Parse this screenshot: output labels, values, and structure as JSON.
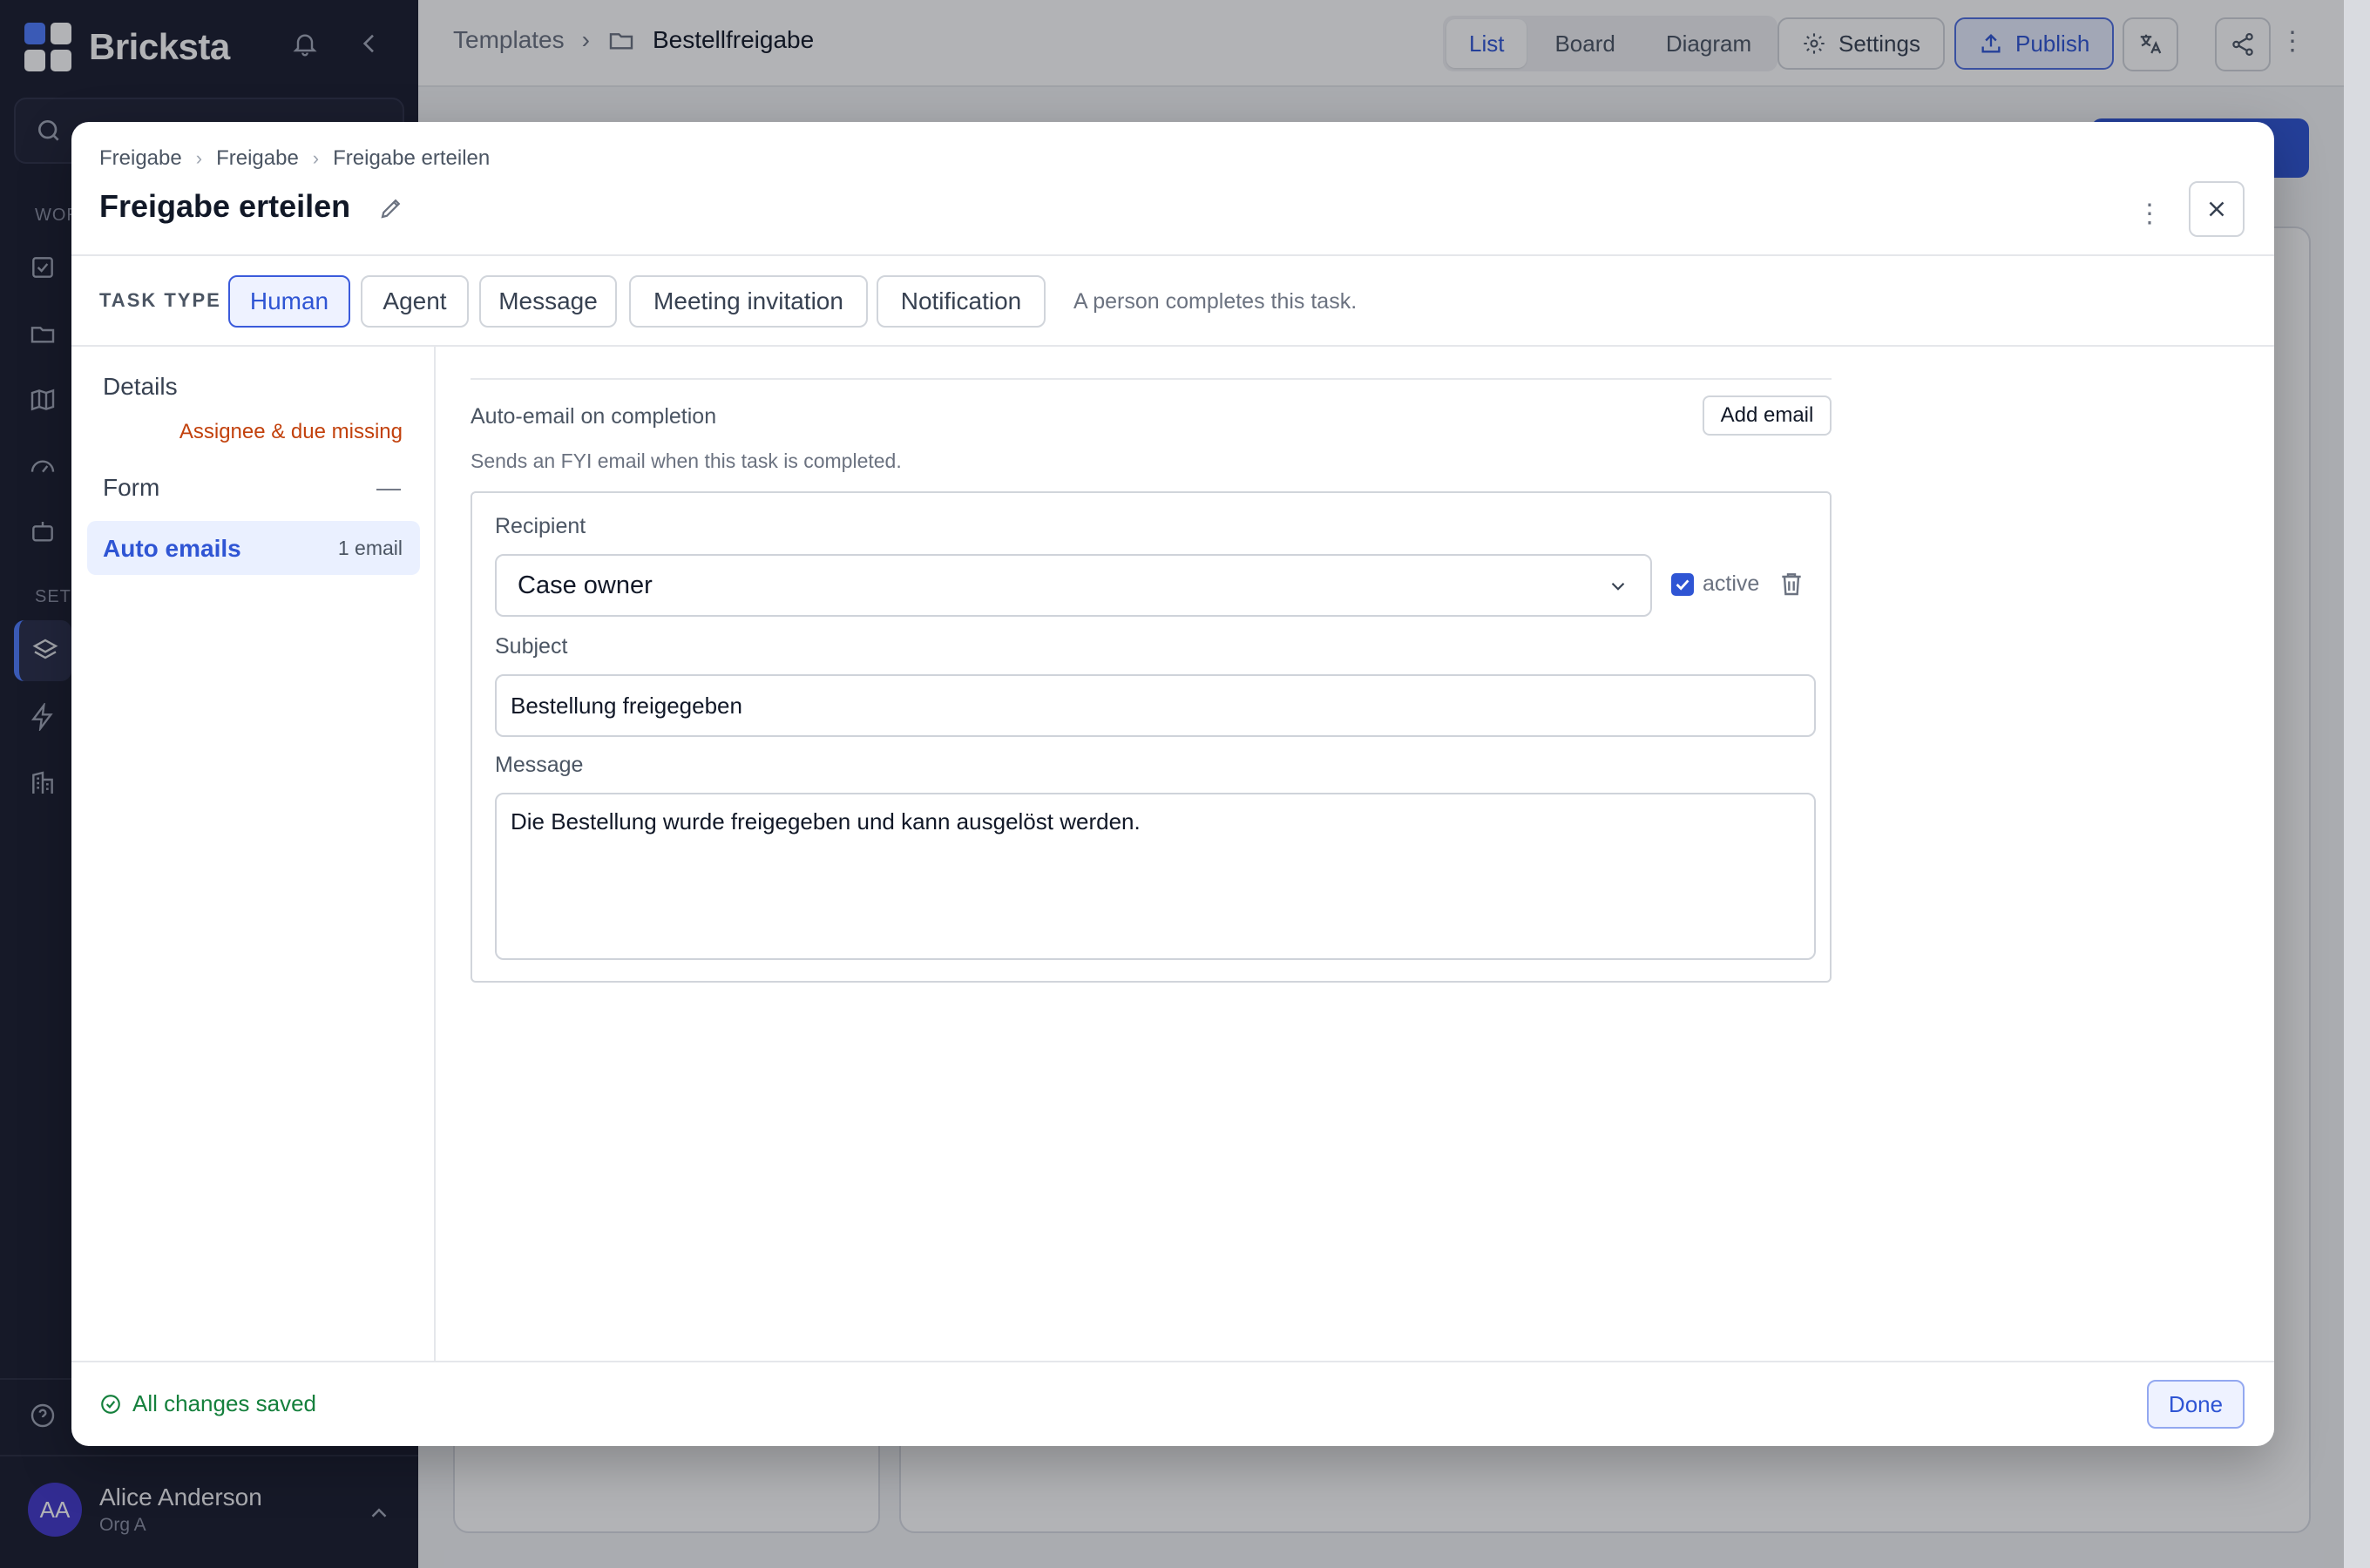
{
  "app": {
    "name": "Bricksta",
    "search_placeholder": "Search",
    "section_work": "WOR",
    "section_setup": "SETU",
    "user": {
      "initials": "AA",
      "name": "Alice Anderson",
      "org": "Org A"
    }
  },
  "topbar": {
    "breadcrumb": [
      "Templates",
      "Bestellfreigabe"
    ],
    "views": [
      "List",
      "Board",
      "Diagram"
    ],
    "active_view": "List",
    "settings_label": "Settings",
    "publish_label": "Publish"
  },
  "modal": {
    "breadcrumb": [
      "Freigabe",
      "Freigabe",
      "Freigabe erteilen"
    ],
    "title": "Freigabe erteilen",
    "task_type_label": "TASK TYPE",
    "task_types": [
      "Human",
      "Agent",
      "Message",
      "Meeting invitation",
      "Notification"
    ],
    "active_task_type": "Human",
    "task_type_hint": "A person completes this task.",
    "nav": {
      "details": "Details",
      "details_warning": "Assignee & due missing",
      "form": "Form",
      "form_status": "—",
      "auto_emails": "Auto emails",
      "auto_emails_count": "1 email"
    },
    "content": {
      "heading": "Auto-email on completion",
      "subheading": "Sends an FYI email when this task is completed.",
      "add_email_label": "Add email",
      "recipient_label": "Recipient",
      "recipient_value": "Case owner",
      "active_label": "active",
      "active_checked": true,
      "subject_label": "Subject",
      "subject_value": "Bestellung freigegeben",
      "message_label": "Message",
      "message_value": "Die Bestellung wurde freigegeben und kann ausgelöst werden."
    },
    "footer": {
      "status": "All changes saved",
      "done_label": "Done"
    }
  },
  "colors": {
    "accent": "#2f55d4",
    "sidebar_bg": "#1a1d2e",
    "warning": "#c2410c",
    "success": "#15803d"
  }
}
